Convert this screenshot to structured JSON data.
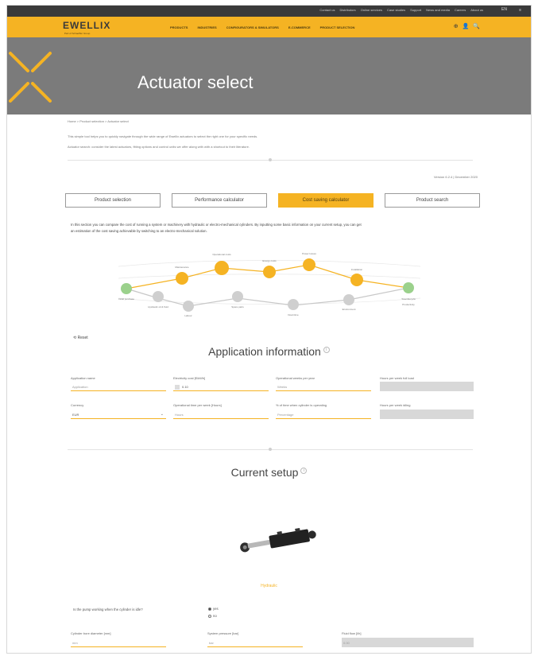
{
  "util_links": [
    "Contact us",
    "Distributors",
    "Online services",
    "Case studies",
    "Support",
    "News and media",
    "Careers",
    "About us"
  ],
  "lang": "EN",
  "menu": "≡",
  "brand": {
    "logo": "EWELLIX",
    "tagline": "Part of Schaeffler Group"
  },
  "nav": [
    "PRODUCTS",
    "INDUSTRIES",
    "CONFIGURATORS & SIMULATORS",
    "E-COMMERCE",
    "PRODUCT SELECTION"
  ],
  "header_icons": [
    "⊕",
    "👤",
    "🔍"
  ],
  "hero_title": "Actuator select",
  "breadcrumb": "Home > Product selection > Actuator select",
  "intro": [
    "This simple tool helps you to quickly navigate through the wide range of Ewellix actuators to select the right one for your specific needs.",
    "Actuator search: consider the latest actuators, fitting options and control units we offer along with with a shortcut to their literature."
  ],
  "version": "Version 6.2.4 | December 2020",
  "tabs": [
    {
      "label": "Product selection",
      "active": false
    },
    {
      "label": "Performance calculator",
      "active": false
    },
    {
      "label": "Cost saving calculator",
      "active": true
    },
    {
      "label": "Product search",
      "active": false
    }
  ],
  "section_desc": [
    "In this section you can compare the cost of running a system or machinery with hydraulic or electro-mechanical cylinders. By inputting some basic information on your current setup, you can get",
    "an estimation of the cost saving achievable by switching to an electro-mechanical solution."
  ],
  "diagram": {
    "top_labels": [
      "Maintenance",
      "Operational costs",
      "Energy costs",
      "Power losses",
      "Installation",
      "Total lifecycle"
    ],
    "bottom_labels": [
      "Initial purchase",
      "Hydraulic oil & fluid",
      "Labour",
      "Spare parts",
      "Downtime",
      "Environment",
      "Productivity"
    ],
    "start_label": "Your current system",
    "end_label": "Total savings"
  },
  "reset": "Reset",
  "application": {
    "title": "Application information",
    "fields": [
      {
        "label": "Application name",
        "value": "Application"
      },
      {
        "label": "Electricity cost [€/kWh]",
        "value": "0.10"
      },
      {
        "label": "Operational weeks per year",
        "value": "Weeks"
      },
      {
        "label": "Hours per week full load",
        "value": ""
      },
      {
        "label": "Currency",
        "value": "EUR"
      },
      {
        "label": "Operational time per week [Hours]",
        "value": "Hours"
      },
      {
        "label": "% of time when cylinder is operating",
        "value": "Percentage"
      },
      {
        "label": "Hours per week idling",
        "value": ""
      }
    ]
  },
  "current_setup": {
    "title": "Current setup",
    "type": "Hydraulic",
    "question": "Is the pump working when the cylinder is idle?",
    "options": [
      {
        "label": "yes",
        "selected": true
      },
      {
        "label": "no",
        "selected": false
      }
    ],
    "fields": [
      {
        "label": "Cylinder bore diameter [mm]",
        "value": "mm"
      },
      {
        "label": "System pressure [bar]",
        "value": "bar"
      },
      {
        "label": "Fluid flow [l/h]",
        "value": "0.00"
      }
    ]
  }
}
